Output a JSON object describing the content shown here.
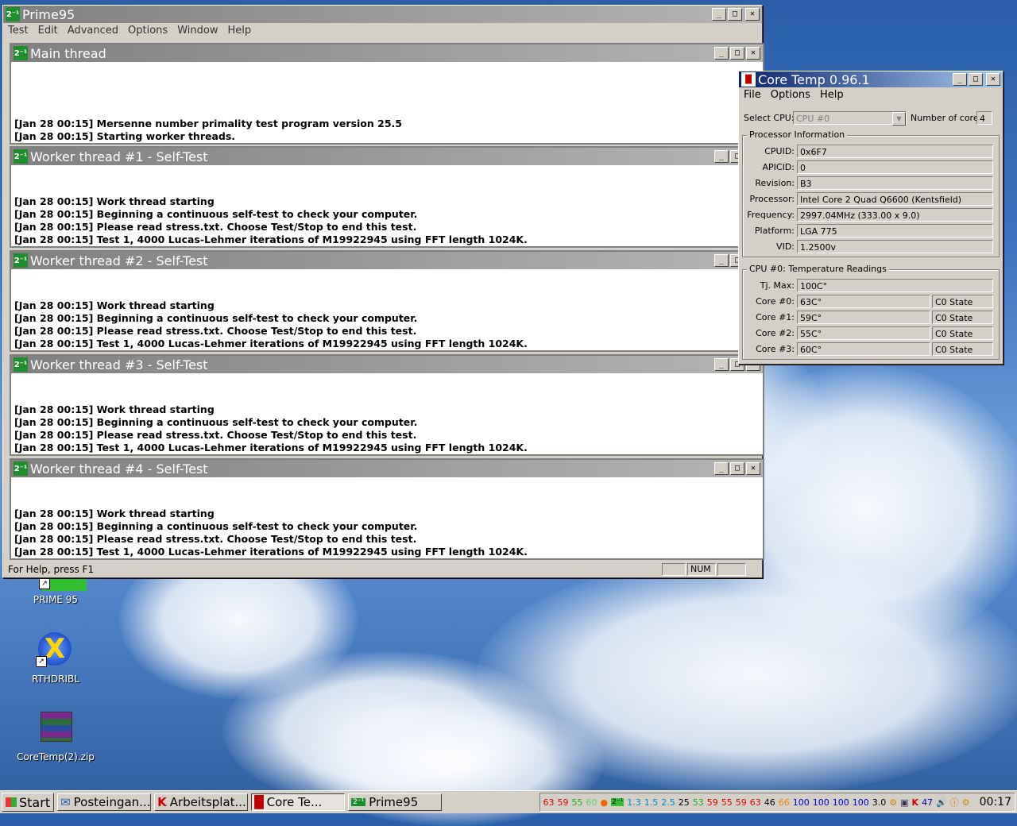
{
  "prime": {
    "title": "Prime95",
    "menu": [
      "Test",
      "Edit",
      "Advanced",
      "Options",
      "Window",
      "Help"
    ],
    "status_text": "For Help, press F1",
    "status_num": "NUM",
    "threads": [
      {
        "title": "Main thread",
        "lines": [
          "[Jan 28 00:15] Mersenne number primality test program version 25.5",
          "[Jan 28 00:15] Starting worker threads."
        ]
      },
      {
        "title": "Worker thread #1 - Self-Test",
        "lines": [
          "[Jan 28 00:15] Work thread starting",
          "[Jan 28 00:15] Beginning a continuous self-test to check your computer.",
          "[Jan 28 00:15] Please read stress.txt.  Choose Test/Stop to end this test.",
          "[Jan 28 00:15] Test 1, 4000 Lucas-Lehmer iterations of M19922945 using FFT length 1024K."
        ]
      },
      {
        "title": "Worker thread #2 - Self-Test",
        "lines": [
          "[Jan 28 00:15] Work thread starting",
          "[Jan 28 00:15] Beginning a continuous self-test to check your computer.",
          "[Jan 28 00:15] Please read stress.txt.  Choose Test/Stop to end this test.",
          "[Jan 28 00:15] Test 1, 4000 Lucas-Lehmer iterations of M19922945 using FFT length 1024K."
        ]
      },
      {
        "title": "Worker thread #3 - Self-Test",
        "lines": [
          "[Jan 28 00:15] Work thread starting",
          "[Jan 28 00:15] Beginning a continuous self-test to check your computer.",
          "[Jan 28 00:15] Please read stress.txt.  Choose Test/Stop to end this test.",
          "[Jan 28 00:15] Test 1, 4000 Lucas-Lehmer iterations of M19922945 using FFT length 1024K."
        ]
      },
      {
        "title": "Worker thread #4 - Self-Test",
        "lines": [
          "[Jan 28 00:15] Work thread starting",
          "[Jan 28 00:15] Beginning a continuous self-test to check your computer.",
          "[Jan 28 00:15] Please read stress.txt.  Choose Test/Stop to end this test.",
          "[Jan 28 00:15] Test 1, 4000 Lucas-Lehmer iterations of M19922945 using FFT length 1024K."
        ]
      }
    ]
  },
  "coretemp": {
    "title": "Core Temp 0.96.1",
    "menu": [
      "File",
      "Options",
      "Help"
    ],
    "select_cpu_label": "Select CPU:",
    "select_cpu_value": "CPU #0",
    "num_cores_label": "Number of cores",
    "num_cores_value": "4",
    "proc_group": "Processor Information",
    "proc": {
      "cpuid_label": "CPUID:",
      "cpuid": "0x6F7",
      "apicid_label": "APICID:",
      "apicid": "0",
      "revision_label": "Revision:",
      "revision": "B3",
      "processor_label": "Processor:",
      "processor": "Intel Core 2 Quad Q6600 (Kentsfield)",
      "frequency_label": "Frequency:",
      "frequency": "2997.04MHz (333.00 x 9.0)",
      "platform_label": "Platform:",
      "platform": "LGA 775",
      "vid_label": "VID:",
      "vid": "1.2500v"
    },
    "temp_group": "CPU #0: Temperature Readings",
    "tjmax_label": "Tj. Max:",
    "tjmax": "100C°",
    "cores": [
      {
        "label": "Core #0:",
        "temp": "63C°",
        "state": "C0 State"
      },
      {
        "label": "Core #1:",
        "temp": "59C°",
        "state": "C0 State"
      },
      {
        "label": "Core #2:",
        "temp": "55C°",
        "state": "C0 State"
      },
      {
        "label": "Core #3:",
        "temp": "60C°",
        "state": "C0 State"
      }
    ]
  },
  "desktop_icons": [
    {
      "label": "PRIME 95",
      "icon": "prime95-icon"
    },
    {
      "label": "RTHDRIBL",
      "icon": "rthdribl-icon"
    },
    {
      "label": "CoreTemp(2).zip",
      "icon": "winrar-archive-icon"
    }
  ],
  "taskbar": {
    "start": "Start",
    "tasks": [
      "Posteingan...",
      "Arbeitsplat...",
      "Core Te...",
      "Prime95"
    ],
    "tray_temps": [
      "63",
      "59",
      "55",
      "60"
    ],
    "tray_nums": [
      "1.3",
      "1.5",
      "2.5",
      "25",
      "53",
      "59",
      "55",
      "59",
      "63",
      "46",
      "66",
      "100",
      "100",
      "100",
      "100",
      "3.0"
    ],
    "tray_misc": "47",
    "clock": "00:17"
  },
  "colors": {
    "active_title": "#0a246a",
    "inactive_title": "#808080",
    "face": "#d4d0c8"
  }
}
